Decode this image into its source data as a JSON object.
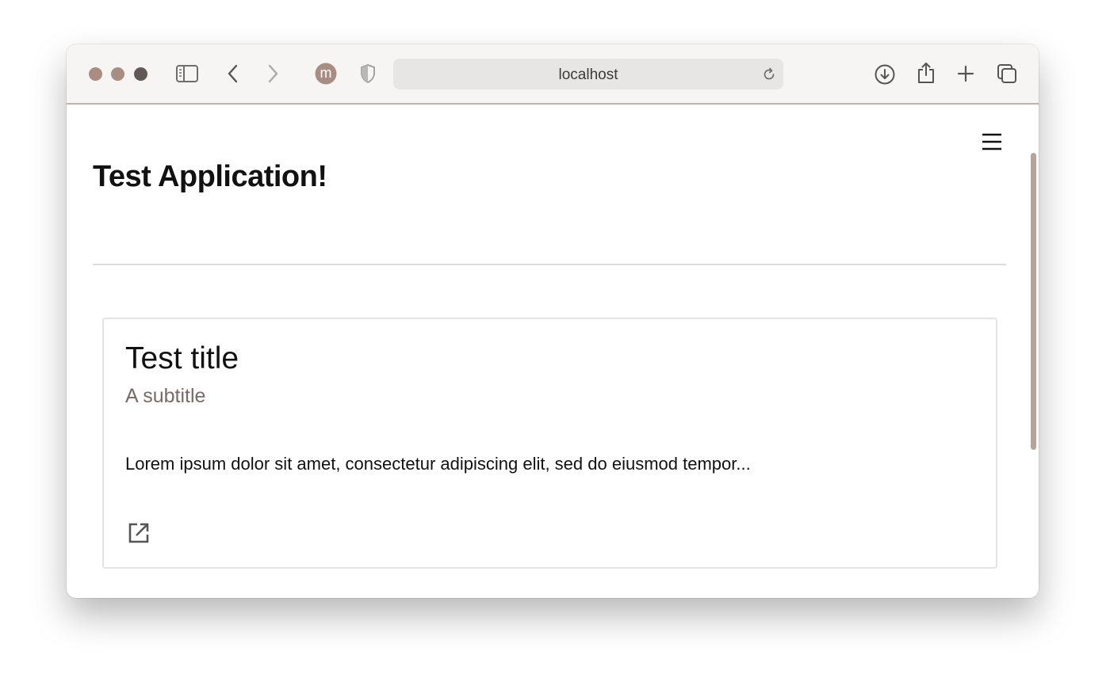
{
  "browser": {
    "url": "localhost",
    "traffic_light_colors": [
      "#a98d83",
      "#a98d83",
      "#615955"
    ],
    "accent_color": "#c4b1a8",
    "profile_initial": "m",
    "icons": [
      "sidebar-icon",
      "back-icon",
      "forward-icon",
      "profile-icon",
      "shield-icon",
      "reload-icon",
      "download-icon",
      "share-icon",
      "new-tab-icon",
      "tabs-overview-icon"
    ]
  },
  "app": {
    "title": "Test Application!",
    "menu_icon": "hamburger-menu-icon"
  },
  "card": {
    "title": "Test title",
    "subtitle": "A subtitle",
    "text": "Lorem ipsum dolor sit amet, consectetur adipiscing elit, sed do eiusmod tempor...",
    "action_icon": "open-in-new-icon"
  }
}
